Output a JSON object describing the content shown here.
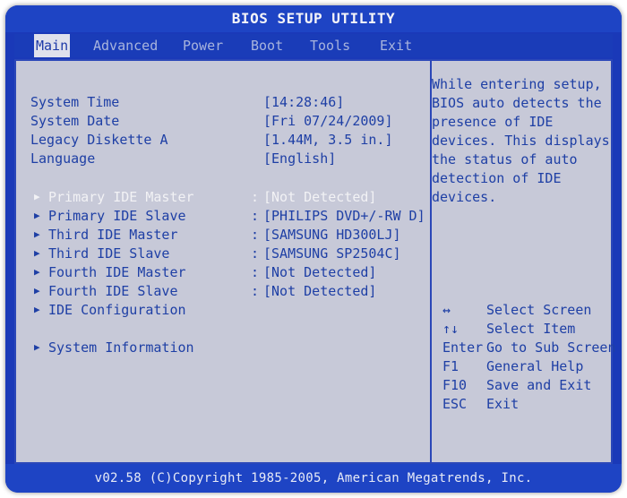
{
  "title": "BIOS SETUP UTILITY",
  "menu": [
    "Main",
    "Advanced",
    "Power",
    "Boot",
    "Tools",
    "Exit"
  ],
  "settings": [
    {
      "label": "System Time",
      "value": "[14:28:46]"
    },
    {
      "label": "System Date",
      "value": "[Fri 07/24/2009]"
    },
    {
      "label": "Legacy Diskette A",
      "value": "[1.44M, 3.5 in.]"
    },
    {
      "label": "Language",
      "value": "[English]"
    }
  ],
  "drives": [
    {
      "label": "Primary IDE Master",
      "value": "[Not Detected]",
      "selected": true
    },
    {
      "label": "Primary IDE Slave",
      "value": "[PHILIPS DVD+/-RW D]"
    },
    {
      "label": "Third IDE Master",
      "value": "[SAMSUNG HD300LJ]"
    },
    {
      "label": "Third IDE Slave",
      "value": "[SAMSUNG SP2504C]"
    },
    {
      "label": "Fourth IDE Master",
      "value": "[Not Detected]"
    },
    {
      "label": "Fourth IDE Slave",
      "value": "[Not Detected]"
    }
  ],
  "separator": ":",
  "submenus": [
    "IDE Configuration",
    "System Information"
  ],
  "help_text": [
    "While entering setup,",
    "BIOS auto detects the",
    "presence of IDE",
    "devices. This displays",
    "the status of auto",
    "detection of IDE",
    "devices."
  ],
  "keys": [
    {
      "key": "↔",
      "action": "Select Screen"
    },
    {
      "key": "↑↓",
      "action": "Select Item"
    },
    {
      "key": "Enter",
      "action": "Go to Sub Screen"
    },
    {
      "key": "F1",
      "action": "General Help"
    },
    {
      "key": "F10",
      "action": "Save and Exit"
    },
    {
      "key": "ESC",
      "action": "Exit"
    }
  ],
  "footer": "v02.58 (C)Copyright 1985-2005, American Megatrends, Inc.",
  "colors": {
    "background": "#1a39b8",
    "panel": "#c7c9d8",
    "text": "#1e3fa5",
    "highlight": "#f2f2f5"
  }
}
